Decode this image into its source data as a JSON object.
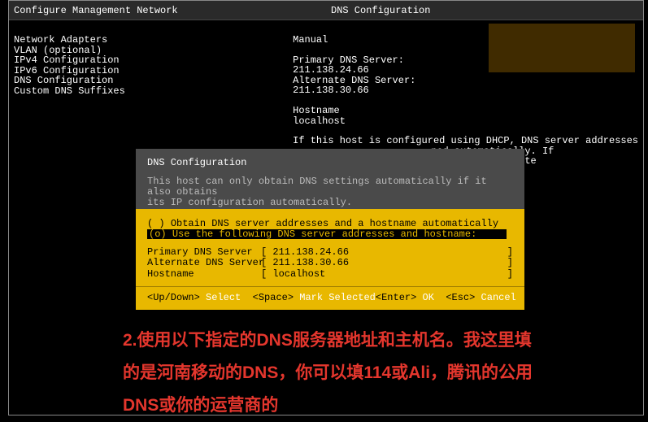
{
  "header": {
    "left": "Configure Management Network",
    "right": "DNS Configuration"
  },
  "sidebar": {
    "items": [
      "Network Adapters",
      "VLAN (optional)",
      "",
      "IPv4 Configuration",
      "IPv6 Configuration",
      "DNS Configuration",
      "Custom DNS Suffixes"
    ]
  },
  "detail": {
    "manual": "Manual",
    "primary_label": "Primary DNS Server:",
    "primary_value": "211.138.24.66",
    "alternate_label": "Alternate DNS Server:",
    "alternate_value": "211.138.30.66",
    "hostname_label": "Hostname",
    "hostname_value": "localhost",
    "hint1": "If this host is configured using DHCP, DNS server addresses",
    "hint2": "ned automatically. If",
    "hint3": "or the appropriate"
  },
  "dialog": {
    "title": "DNS Configuration",
    "desc": "This host can only obtain DNS settings automatically if it also obtains\nits IP configuration automatically.",
    "options": [
      {
        "marker": "( )",
        "text": "Obtain DNS server addresses and a hostname automatically",
        "selected": false
      },
      {
        "marker": "(o)",
        "text": "Use the following DNS server addresses and hostname:",
        "selected": true
      }
    ],
    "fields": {
      "primary": {
        "label": "Primary DNS Server",
        "value": "211.138.24.66"
      },
      "alternate": {
        "label": "Alternate DNS Server",
        "value": "211.138.30.66"
      },
      "hostname": {
        "label": "Hostname",
        "value": "localhost"
      }
    },
    "footer": {
      "updown": "<Up/Down>",
      "select": "Select",
      "space": "<Space>",
      "mark": "Mark Selected",
      "enter": "<Enter>",
      "ok": "OK",
      "esc": "<Esc>",
      "cancel": "Cancel"
    }
  },
  "annotation": "2.使用以下指定的DNS服务器地址和主机名。我这里填的是河南移动的DNS，你可以填114或Ali，腾讯的公用DNS或你的运营商的"
}
